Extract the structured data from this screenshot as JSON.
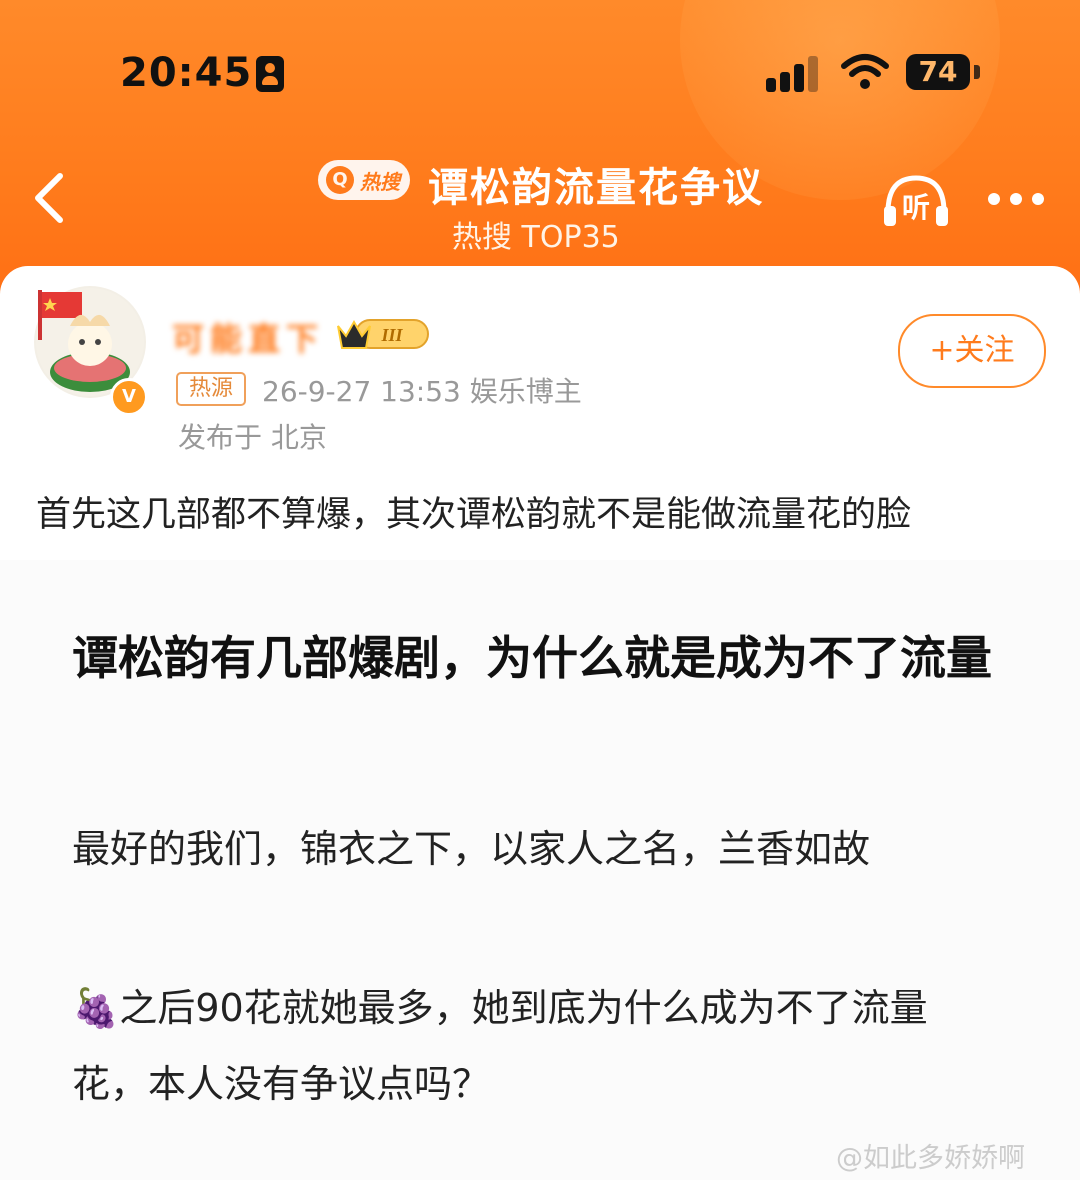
{
  "status_bar": {
    "time": "20:45",
    "battery": "74"
  },
  "header": {
    "badge_text": "热搜",
    "topic_title": "谭松韵流量花争议",
    "topic_sub": "热搜 TOP35",
    "listen_label": "听"
  },
  "post": {
    "username": "可能直下",
    "level_badge": "III",
    "follow_label": "+关注",
    "source_label": "热源",
    "meta": "26-9-27 13:53  娱乐博主",
    "location": "发布于 北京",
    "text": "首先这几部都不算爆，其次谭松韵就不是能做流量花的脸"
  },
  "image_text": {
    "title": "谭松韵有几部爆剧，为什么就是成为不了流量",
    "line1": "最好的我们，锦衣之下，以家人之名，兰香如故",
    "line2": "🍇之后90花就她最多，她到底为什么成为不了流量花，本人没有争议点吗？"
  },
  "watermark": "@如此多娇娇啊",
  "colors": {
    "brand_orange": "#ff7b1c",
    "text_dark": "#222222",
    "meta_gray": "#999999"
  }
}
